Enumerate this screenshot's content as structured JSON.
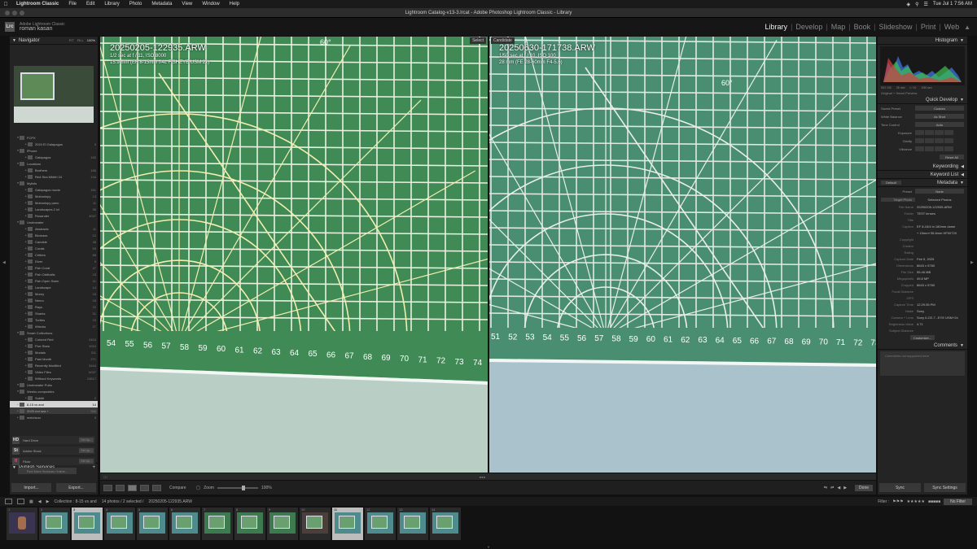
{
  "menubar": {
    "app": "Lightroom Classic",
    "items": [
      "File",
      "Edit",
      "Library",
      "Photo",
      "Metadata",
      "View",
      "Window",
      "Help"
    ],
    "clock": "Tue Jul 1  7:56 AM"
  },
  "window": {
    "title": "Lightroom Catalog-v13-3.lrcat - Adobe Photoshop Lightroom Classic - Library"
  },
  "identity": {
    "product": "Adobe Lightroom Classic",
    "user": "roman kasan",
    "logo": "Lrc"
  },
  "modules": {
    "items": [
      "Library",
      "Develop",
      "Map",
      "Book",
      "Slideshow",
      "Print",
      "Web"
    ],
    "active": "Library"
  },
  "navigator": {
    "title": "Navigator",
    "zooms": [
      "FIT",
      "FILL",
      "100%"
    ],
    "active_zoom": "100%"
  },
  "collections": [
    {
      "name": "FCPX",
      "count": "",
      "level": 1,
      "folder": true
    },
    {
      "name": "2024 El Galapagos",
      "count": "3",
      "level": 2
    },
    {
      "name": "iPhone",
      "count": "",
      "level": 1,
      "folder": true
    },
    {
      "name": "Galapagos",
      "count": "182",
      "level": 2
    },
    {
      "name": "Locations",
      "count": "",
      "level": 1,
      "folder": true
    },
    {
      "name": "Brothers",
      "count": "166",
      "level": 2
    },
    {
      "name": "Red Sea Mkhfri 24",
      "count": "134",
      "level": 2
    },
    {
      "name": "Mylists",
      "count": "",
      "level": 1,
      "folder": true
    },
    {
      "name": "Galapagos movie",
      "count": "151",
      "level": 2
    },
    {
      "name": "Moboslopy",
      "count": "13",
      "level": 2
    },
    {
      "name": "Moboslopy pano",
      "count": "11",
      "level": 2
    },
    {
      "name": "Landscapes 2 lvl",
      "count": "36",
      "level": 2
    },
    {
      "name": "Rosander",
      "count": "4037",
      "level": 2
    },
    {
      "name": "Underwater",
      "count": "",
      "level": 1,
      "folder": true
    },
    {
      "name": "Abstracts",
      "count": "11",
      "level": 2
    },
    {
      "name": "Biomass",
      "count": "12",
      "level": 2
    },
    {
      "name": "Candide",
      "count": "38",
      "level": 2
    },
    {
      "name": "Corals",
      "count": "55",
      "level": 2
    },
    {
      "name": "Critters",
      "count": "88",
      "level": 2
    },
    {
      "name": "Diver",
      "count": "9",
      "level": 2
    },
    {
      "name": "Fish Coral",
      "count": "47",
      "level": 2
    },
    {
      "name": "Fish Oddballs",
      "count": "23",
      "level": 2
    },
    {
      "name": "Fish Open Swim",
      "count": "41",
      "level": 2
    },
    {
      "name": "Landscape",
      "count": "14",
      "level": 2
    },
    {
      "name": "Morey",
      "count": "16",
      "level": 2
    },
    {
      "name": "Nemo",
      "count": "18",
      "level": 2
    },
    {
      "name": "Rays",
      "count": "22",
      "level": 2
    },
    {
      "name": "Sharks",
      "count": "31",
      "level": 2
    },
    {
      "name": "Turtles",
      "count": "19",
      "level": 2
    },
    {
      "name": "Wrecks",
      "count": "27",
      "level": 2
    },
    {
      "name": "Smart Collections",
      "count": "",
      "level": 1,
      "folder": true
    },
    {
      "name": "Colored Red",
      "count": "2404",
      "level": 2
    },
    {
      "name": "Five Stars",
      "count": "1024",
      "level": 2
    },
    {
      "name": "Modals",
      "count": "311",
      "level": 2
    },
    {
      "name": "Past Month",
      "count": "271",
      "level": 2
    },
    {
      "name": "Recently Modified",
      "count": "3444",
      "level": 2
    },
    {
      "name": "Video Files",
      "count": "6037",
      "level": 2
    },
    {
      "name": "Without Keywords",
      "count": "13617",
      "level": 2
    },
    {
      "name": "Underwater Pubs",
      "count": "",
      "level": 1,
      "folder": true
    },
    {
      "name": "Weeks composites",
      "count": "",
      "level": 1,
      "folder": true
    },
    {
      "name": "Subtitl",
      "count": "2",
      "level": 2
    },
    {
      "name": "8-15 vs and",
      "count": "14",
      "level": 1,
      "selected": true
    },
    {
      "name": "2025 red sea +",
      "count": "556",
      "level": 1,
      "dark": true
    },
    {
      "name": "melchiorx",
      "count": "3",
      "level": 1
    }
  ],
  "publish": {
    "title": "Publish Services",
    "items": [
      {
        "icon": "HD",
        "name": "Hard Drive",
        "action": "Set Up..."
      },
      {
        "icon": "St",
        "name": "Adobe Stock",
        "action": "Set Up..."
      },
      {
        "icon": "fl",
        "name": "Flickr",
        "action": "Set Up..."
      }
    ],
    "find_more": "Find More Services Online..."
  },
  "left_buttons": {
    "import": "Import...",
    "export": "Export..."
  },
  "compare": {
    "left": {
      "tag": "Select",
      "filename": "20250205-122935.ARW",
      "line1": "1/2 sec at f / 11, ISO 8000",
      "line2": "15.9 mm (EF 8-15mm f/4L FISHEYE USM 2x)"
    },
    "right": {
      "tag": "Candidate",
      "filename": "20250630-171738.ARW",
      "line1": "1/50 sec at f / 10, ISO 100",
      "line2": "28 mm (FE 28-60mm F4-5.6)"
    },
    "ruler_left": [
      "54",
      "55",
      "56",
      "57",
      "58",
      "59",
      "60",
      "61",
      "62",
      "63",
      "64",
      "65",
      "66",
      "67",
      "68",
      "69",
      "70",
      "71",
      "72",
      "73",
      "74"
    ],
    "ruler_right": [
      "51",
      "52",
      "53",
      "54",
      "55",
      "56",
      "57",
      "58",
      "59",
      "60",
      "61",
      "62",
      "63",
      "64",
      "65",
      "66",
      "67",
      "68",
      "69",
      "70",
      "71",
      "72",
      "73"
    ],
    "angle_label": "60°"
  },
  "toolbar": {
    "compare_label": "Compare",
    "zoom_label": "Zoom",
    "zoom_value": "100%",
    "done": "Done"
  },
  "histogram": {
    "title": "Histogram",
    "info": [
      "ISO 100",
      "28 mm",
      "f / 10",
      "1/50 sec"
    ],
    "smart": "Original + Smart Preview"
  },
  "quick_develop": {
    "title": "Quick Develop",
    "saved_preset_label": "Saved Preset",
    "saved_preset_value": "Custom",
    "white_balance_label": "White Balance",
    "white_balance_value": "As Shot",
    "tone_control_label": "Tone Control",
    "tone_control_value": "Auto",
    "rows": [
      "Exposure",
      "Clarity",
      "Vibrance"
    ],
    "reset": "Reset All"
  },
  "keywording": {
    "title": "Keywording"
  },
  "keyword_list": {
    "title": "Keyword List"
  },
  "metadata": {
    "title": "Metadata",
    "preset": "Default",
    "preset_label": "Preset",
    "preset_value": "None",
    "target_label": "Target Photo",
    "target_value": "Selected Photos",
    "fields": [
      {
        "k": "File Name",
        "v": "20250205-122935.ARW"
      },
      {
        "k": "Folder",
        "v": "TEST lenses"
      },
      {
        "k": "Title",
        "v": ""
      },
      {
        "k": "Caption",
        "v": "EF 8-15/4 in 180mm dome"
      },
      {
        "k": "",
        "v": "+ 15mm+35.6mm HF00720"
      },
      {
        "k": "Copyright",
        "v": ""
      },
      {
        "k": "Creator",
        "v": ""
      },
      {
        "k": "Rating",
        "v": ""
      },
      {
        "k": "Capture Date",
        "v": "Feb 5, 2025"
      },
      {
        "k": "Dimensions",
        "v": "8643 x 5760"
      },
      {
        "k": "File Size",
        "v": "55.46 MB"
      },
      {
        "k": "Megapixels",
        "v": "49.8 MP"
      },
      {
        "k": "Cropped",
        "v": "8643 x 5760"
      },
      {
        "k": "Focal Distance",
        "v": ""
      },
      {
        "k": "GPS",
        "v": ""
      },
      {
        "k": "Capture Time",
        "v": "12:29:35 PM"
      },
      {
        "k": "Make",
        "v": "Sony"
      },
      {
        "k": "Camera + Lens",
        "v": "Sony ILCE-7...EYE USM+2x"
      },
      {
        "k": "Brightness Value",
        "v": "4.71"
      },
      {
        "k": "Subject Distance",
        "v": ""
      }
    ],
    "customize": "Customize..."
  },
  "comments": {
    "title": "Comments",
    "placeholder": "Comments not supported here"
  },
  "right_buttons": {
    "sync": "Sync",
    "sync_settings": "Sync Settings"
  },
  "filmstrip_bar": {
    "collection": "Collection : 8-15 vs and",
    "count": "14 photos / 2 selected /",
    "current": "20250205-122935.ARW",
    "filter_label": "Filter :",
    "filter_value": "No Filter"
  },
  "filmstrip": [
    {
      "n": "1",
      "t": "person"
    },
    {
      "n": "2",
      "t": "teal"
    },
    {
      "n": "3",
      "t": "teal",
      "sel": true
    },
    {
      "n": "4",
      "t": "teal"
    },
    {
      "n": "5",
      "t": "teal"
    },
    {
      "n": "6",
      "t": "teal"
    },
    {
      "n": "7",
      "t": "green"
    },
    {
      "n": "8",
      "t": "green"
    },
    {
      "n": "9",
      "t": "green"
    },
    {
      "n": "10",
      "t": "dark"
    },
    {
      "n": "11",
      "t": "teal",
      "sel": true
    },
    {
      "n": "12",
      "t": "teal"
    },
    {
      "n": "13",
      "t": "teal"
    },
    {
      "n": "14",
      "t": "teal"
    }
  ]
}
